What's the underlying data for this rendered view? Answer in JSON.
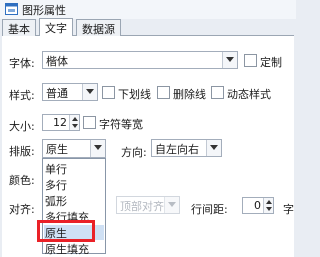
{
  "window": {
    "title": "图形属性"
  },
  "tabs": [
    "基本",
    "文字",
    "数据源"
  ],
  "font": {
    "label": "字体:",
    "value": "楷体",
    "custom_label": "定制"
  },
  "style": {
    "label": "样式:",
    "value": "普通",
    "underline_label": "下划线",
    "strikethrough_label": "删除线",
    "dynamic_style_label": "动态样式"
  },
  "size": {
    "label": "大小:",
    "value": "12",
    "monospace_label": "字符等宽"
  },
  "layout": {
    "label": "排版:",
    "value": "原生",
    "direction_label": "方向:",
    "direction_value": "自左向右"
  },
  "color": {
    "label": "颜色:"
  },
  "align": {
    "label": "对齐:",
    "vertical_value": "顶部对齐",
    "line_spacing_label": "行间距:",
    "line_spacing_value": "0",
    "overflow_char": "字"
  },
  "layout_options": {
    "items": [
      "单行",
      "多行",
      "弧形",
      "多行填充",
      "原生",
      "原生填充"
    ],
    "selected": "原生"
  },
  "colors": {
    "highlight": "#ea2127",
    "selection": "#cfe0f4"
  }
}
